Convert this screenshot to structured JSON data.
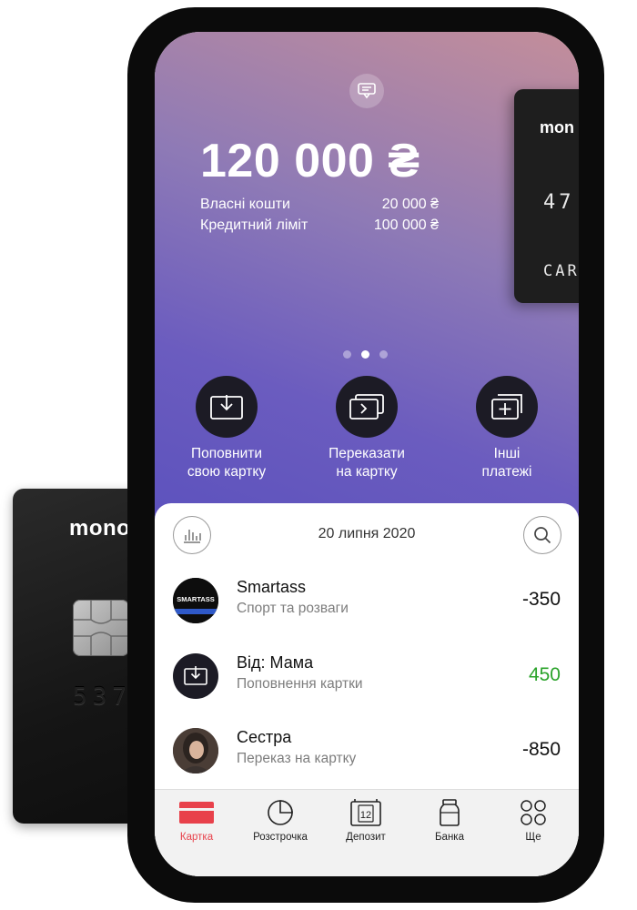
{
  "card": {
    "logo": "mono",
    "number_partial": "537",
    "virtual_logo": "mon",
    "virtual_number": "47",
    "virtual_type": "CAR"
  },
  "balance": {
    "total": "120 000 ₴",
    "own_label": "Власні кошти",
    "own_value": "20 000 ₴",
    "credit_label": "Кредитний ліміт",
    "credit_value": "100 000 ₴"
  },
  "pager": {
    "count": 3,
    "active": 2
  },
  "actions": [
    {
      "label_line1": "Поповнити",
      "label_line2": "свою картку",
      "icon": "download-card-icon"
    },
    {
      "label_line1": "Переказати",
      "label_line2": "на картку",
      "icon": "transfer-card-icon"
    },
    {
      "label_line1": "Інші",
      "label_line2": "платежі",
      "icon": "add-card-icon"
    }
  ],
  "feed": {
    "date": "20 липня 2020",
    "transactions": [
      {
        "name": "Smartass",
        "category": "Спорт та розваги",
        "amount": "-350",
        "avatar_text": "SMARTASS"
      },
      {
        "name": "Від: Мама",
        "category": "Поповнення картки",
        "amount": "450"
      },
      {
        "name": "Сестра",
        "category": "Переказ на картку",
        "amount": "-850"
      }
    ]
  },
  "tabs": [
    {
      "label": "Картка",
      "icon": "card-icon",
      "active": true
    },
    {
      "label": "Розстрочка",
      "icon": "pie-chart-icon"
    },
    {
      "label": "Депозит",
      "icon": "calendar-12-icon",
      "icon_text": "12"
    },
    {
      "label": "Банка",
      "icon": "jar-icon"
    },
    {
      "label": "Ще",
      "icon": "grid-circles-icon"
    }
  ],
  "colors": {
    "accent_red": "#e8414b",
    "positive_green": "#2aa32a",
    "action_circle": "#1c1b25"
  }
}
